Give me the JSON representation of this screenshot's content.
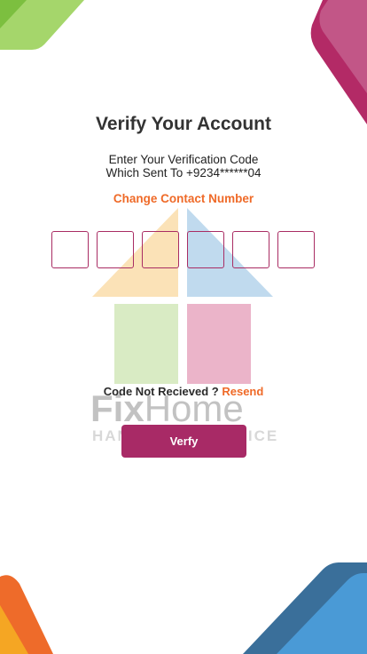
{
  "title": "Verify Your Account",
  "subtitle_line1": "Enter Your Verification Code",
  "subtitle_line2": "Which Sent To +9234******04",
  "change_contact_label": "Change Contact Number",
  "code_digits": [
    "",
    "",
    "",
    "",
    "",
    ""
  ],
  "not_received_label": "Code Not Recieved ?",
  "resend_label": "Resend",
  "verify_label": "Verfy",
  "watermark": {
    "brand_fix": "Fix",
    "brand_home": "Home",
    "tagline": "HANDYMAN SERVICE"
  },
  "colors": {
    "accent": "#a82a66",
    "link": "#ef6a28",
    "green": "#8bc34a",
    "blue": "#3e8fcb",
    "orange": "#f08a24"
  }
}
